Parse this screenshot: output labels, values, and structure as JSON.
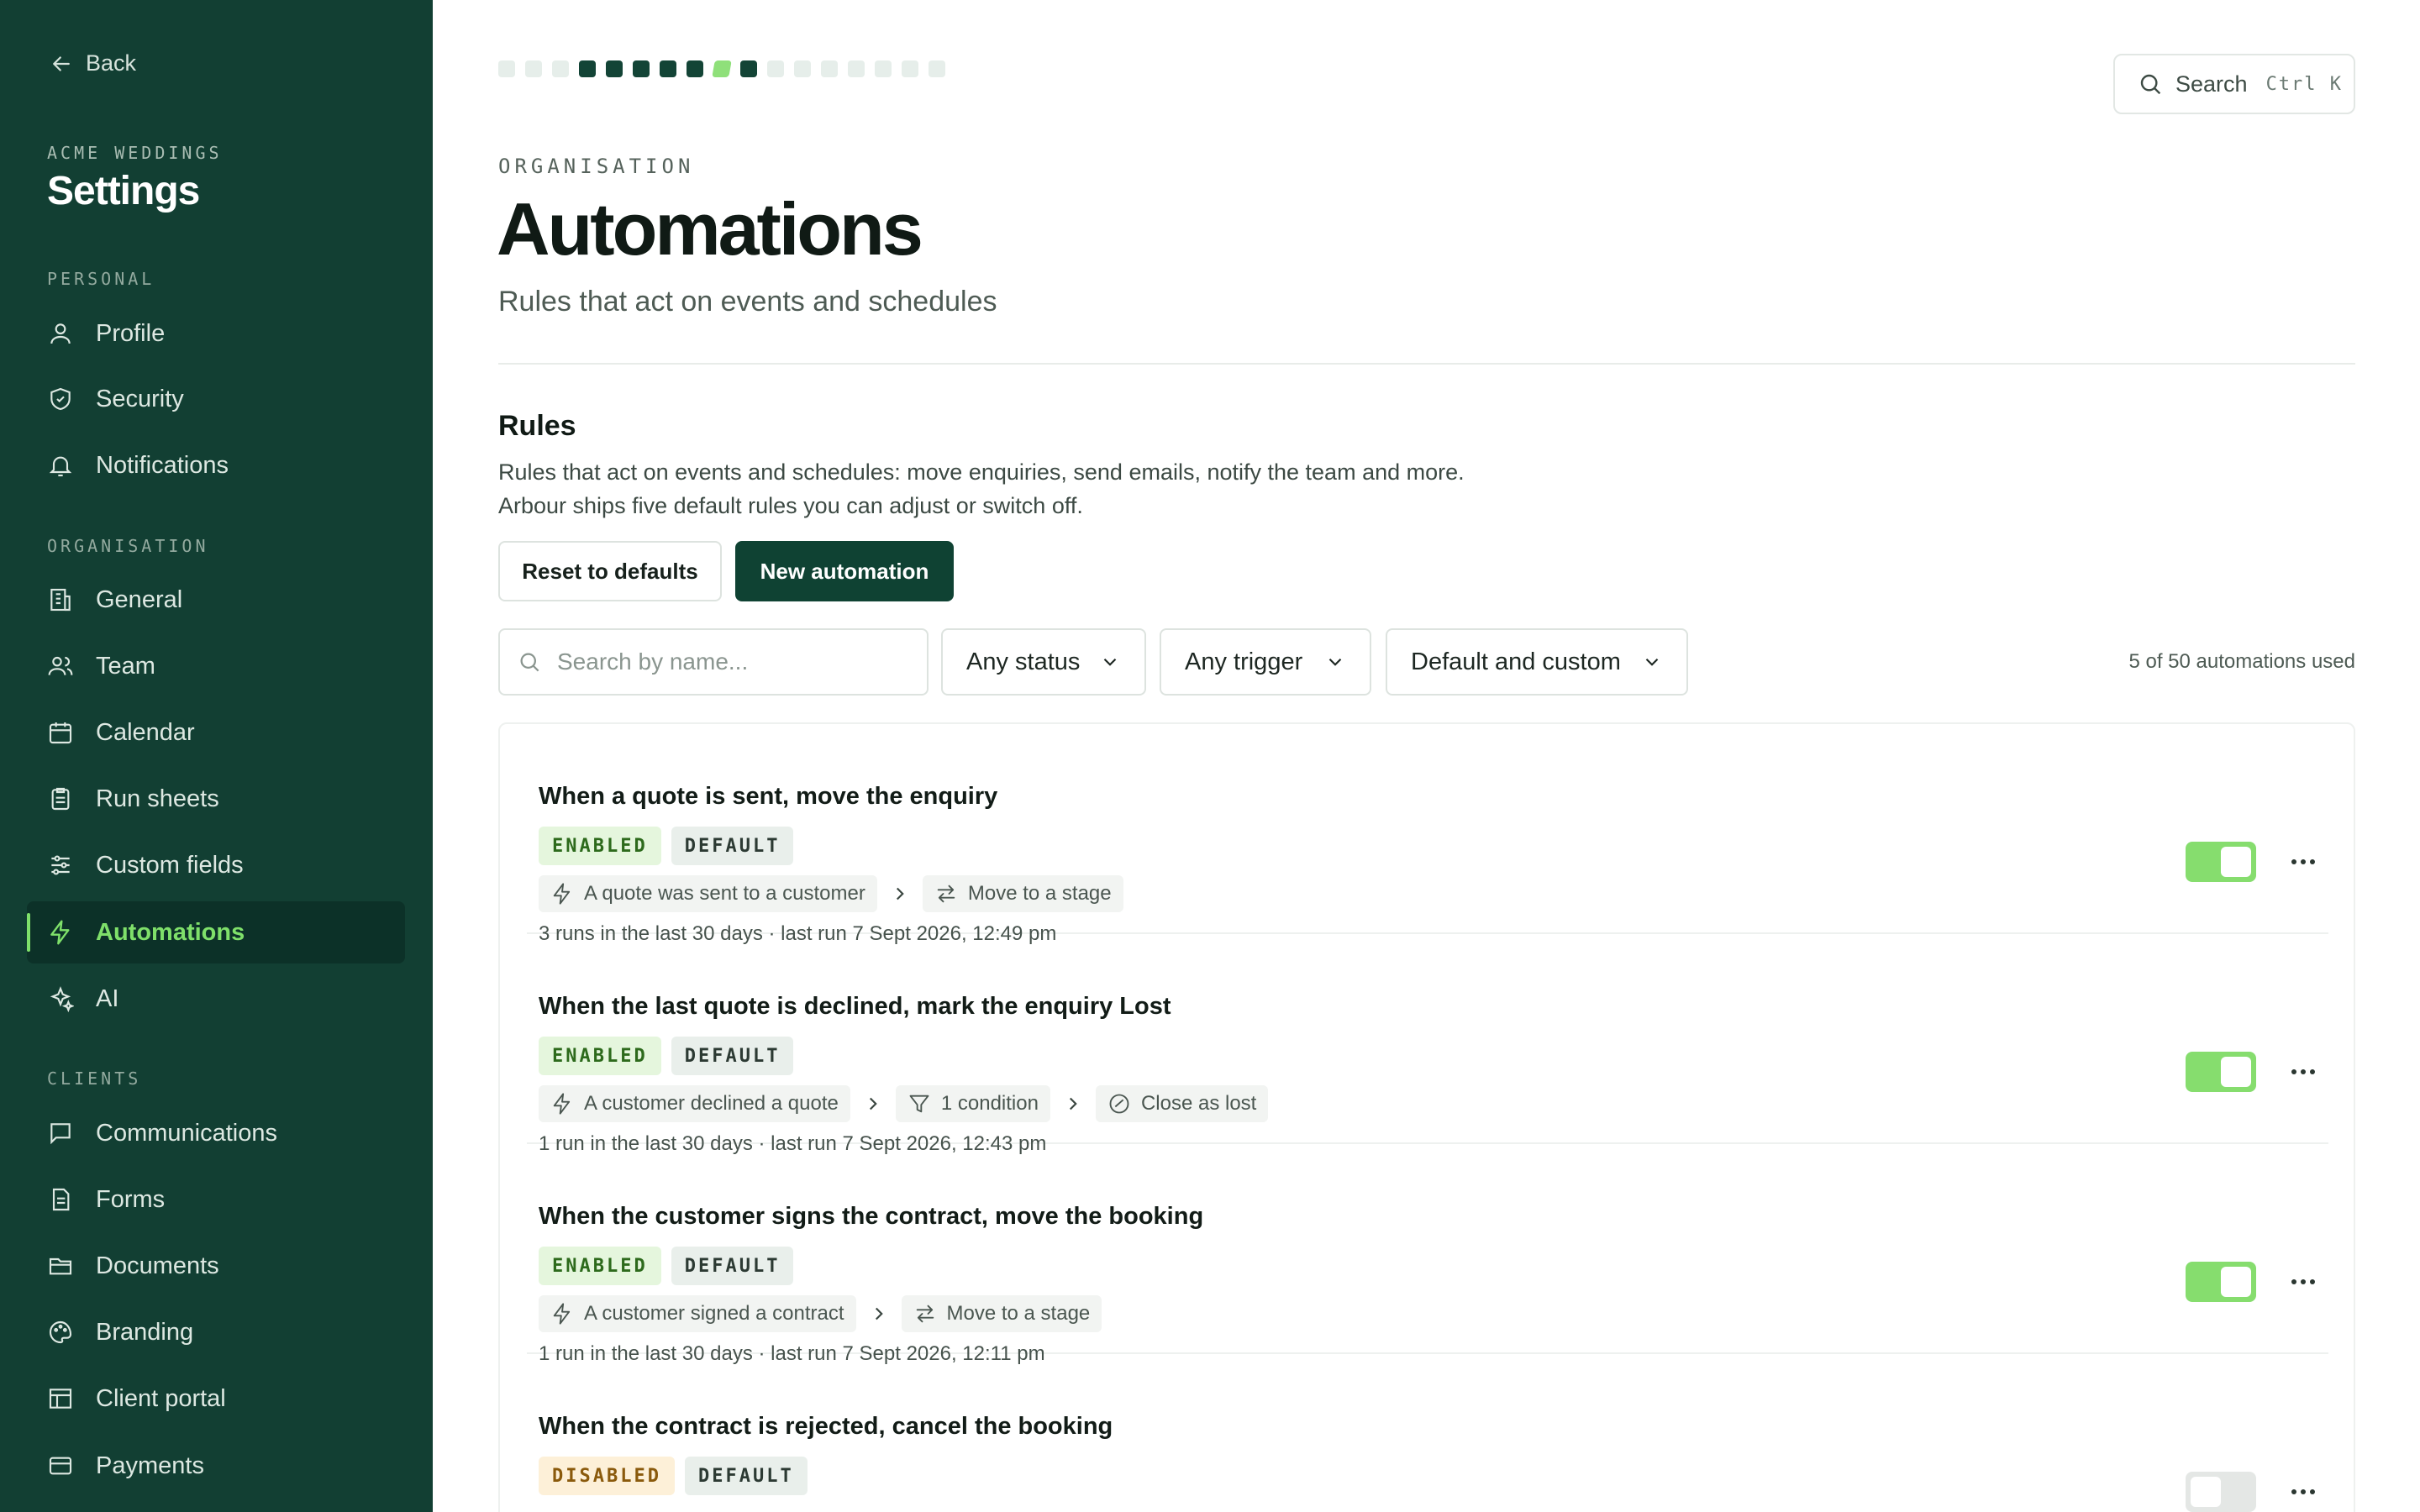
{
  "sidebar": {
    "back_label": "Back",
    "org_name": "ACME WEDDINGS",
    "title": "Settings",
    "sections": {
      "personal": "PERSONAL",
      "organisation": "ORGANISATION",
      "clients": "CLIENTS"
    },
    "items": [
      {
        "label": "Profile",
        "icon": "user-icon"
      },
      {
        "label": "Security",
        "icon": "shield-icon"
      },
      {
        "label": "Notifications",
        "icon": "bell-icon"
      },
      {
        "label": "General",
        "icon": "building-icon"
      },
      {
        "label": "Team",
        "icon": "users-icon"
      },
      {
        "label": "Calendar",
        "icon": "calendar-icon"
      },
      {
        "label": "Run sheets",
        "icon": "clipboard-icon"
      },
      {
        "label": "Custom fields",
        "icon": "sliders-icon"
      },
      {
        "label": "Automations",
        "icon": "lightning-icon",
        "active": true
      },
      {
        "label": "AI",
        "icon": "sparkles-icon"
      },
      {
        "label": "Communications",
        "icon": "message-icon"
      },
      {
        "label": "Forms",
        "icon": "form-icon"
      },
      {
        "label": "Documents",
        "icon": "folder-icon"
      },
      {
        "label": "Branding",
        "icon": "palette-icon"
      },
      {
        "label": "Client portal",
        "icon": "layout-icon"
      },
      {
        "label": "Payments",
        "icon": "card-icon"
      }
    ]
  },
  "header": {
    "search_label": "Search",
    "search_shortcut": "Ctrl K",
    "eyebrow": "ORGANISATION",
    "title": "Automations",
    "subtitle": "Rules that act on events and schedules"
  },
  "rules_section": {
    "title": "Rules",
    "description_line1": "Rules that act on events and schedules: move enquiries, send emails, notify the team and more.",
    "description_line2": "Arbour ships five default rules you can adjust or switch off.",
    "reset_label": "Reset to defaults",
    "new_label": "New automation",
    "search_placeholder": "Search by name...",
    "status_filter": "Any status",
    "trigger_filter": "Any trigger",
    "type_filter": "Default and custom",
    "usage": "5 of 50 automations used"
  },
  "rules": [
    {
      "title": "When a quote is sent, move the enquiry",
      "status": "ENABLED",
      "type": "DEFAULT",
      "trigger": "A quote was sent to a customer",
      "condition": "",
      "action": "Move to a stage",
      "action_icon": "arrows-swap-icon",
      "meta": "3 runs in the last 30 days · last run 7 Sept 2026, 12:49 pm",
      "enabled": true
    },
    {
      "title": "When the last quote is declined, mark the enquiry Lost",
      "status": "ENABLED",
      "type": "DEFAULT",
      "trigger": "A customer declined a quote",
      "condition": "1 condition",
      "action": "Close as lost",
      "action_icon": "circle-slash-icon",
      "meta": "1 run in the last 30 days · last run 7 Sept 2026, 12:43 pm",
      "enabled": true
    },
    {
      "title": "When the customer signs the contract, move the booking",
      "status": "ENABLED",
      "type": "DEFAULT",
      "trigger": "A customer signed a contract",
      "condition": "",
      "action": "Move to a stage",
      "action_icon": "arrows-swap-icon",
      "meta": "1 run in the last 30 days · last run 7 Sept 2026, 12:11 pm",
      "enabled": true
    },
    {
      "title": "When the contract is rejected, cancel the booking",
      "status": "DISABLED",
      "type": "DEFAULT",
      "trigger": "",
      "condition": "",
      "action": "",
      "action_icon": "",
      "meta": "",
      "enabled": false
    }
  ],
  "progress": {
    "total": 17,
    "filled_from": 3,
    "filled_to": 9,
    "current": 8
  }
}
